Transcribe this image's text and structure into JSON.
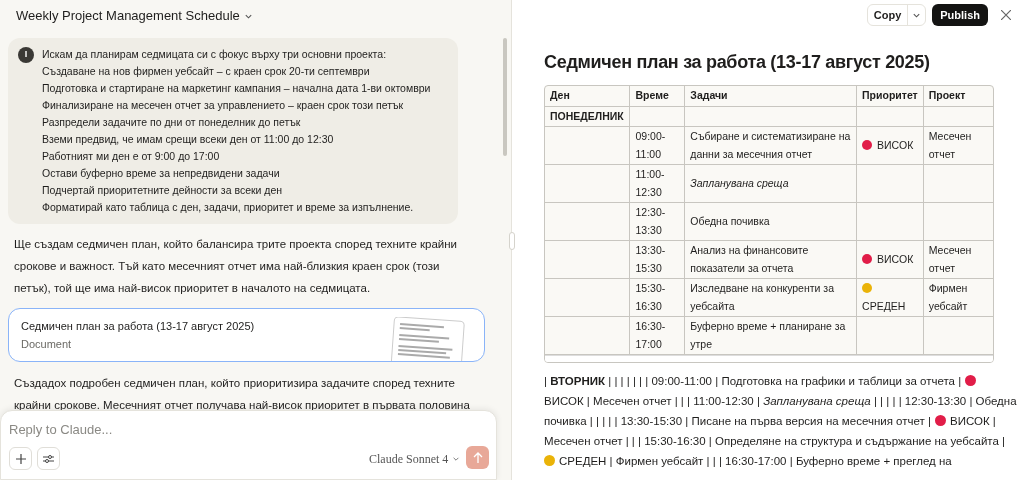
{
  "chat": {
    "title": "Weekly Project Management Schedule",
    "user_message": {
      "avatar": "I",
      "lines": [
        "Искам да планирам седмицата си с фокус върху три основни проекта:",
        "Създаване на нов фирмен уебсайт – с краен срок 20-ти септември",
        "Подготовка и стартиране на маркетинг кампания – начална дата 1-ви октомври",
        "Финализиране на месечен отчет за управлението – краен срок този петък",
        "Разпредели задачите по дни от понеделник до петък",
        "Вземи предвид, че имам срещи всеки ден от 11:00 до 12:30",
        "Работният ми ден е от 9:00 до 17:00",
        "Остави буферно време за непредвидени задачи",
        "Подчертай приоритетните дейности за всеки ден",
        "Форматирай като таблица с ден, задачи, приоритет и време за изпълнение."
      ]
    },
    "reply_before": "Ще създам седмичен план, който балансира трите проекта според техните крайни срокове и важност. Тъй като месечният отчет има най-близкия краен срок (този петък), той ще има най-висок приоритет в началото на седмицата.",
    "artifact": {
      "title": "Седмичен план за работа (13-17 август 2025)",
      "type": "Document"
    },
    "reply_after": "Създадох подробен седмичен план, който приоритизира задачите според техните крайни срокове. Месечният отчет получава най-висок приоритет в първата половина",
    "composer": {
      "placeholder": "Reply to Claude...",
      "model": "Claude Sonnet 4"
    }
  },
  "document": {
    "buttons": {
      "copy": "Copy",
      "publish": "Publish"
    },
    "title": "Седмичен план за работа (13-17 август 2025)",
    "table": {
      "columns": [
        "Ден",
        "Време",
        "Задачи",
        "Приоритет",
        "Проект"
      ],
      "rows": [
        {
          "day": "ПОНЕДЕЛНИК"
        },
        {
          "time": "09:00-11:00",
          "task": "Събиране и систематизиране на данни за месечния отчет",
          "priority": {
            "label": "ВИСОК",
            "color": "#e11d48"
          },
          "project": "Месечен отчет"
        },
        {
          "time": "11:00-12:30",
          "task": "Запланувана среща",
          "task_italic": true
        },
        {
          "time": "12:30-13:30",
          "task": "Обедна почивка"
        },
        {
          "time": "13:30-15:30",
          "task": "Анализ на финансовите показатели за отчета",
          "priority": {
            "label": "ВИСОК",
            "color": "#e11d48"
          },
          "project": "Месечен отчет"
        },
        {
          "time": "15:30-16:30",
          "task": "Изследване на конкуренти за уебсайта",
          "priority": {
            "label": "СРЕДЕН",
            "color": "#eab308"
          },
          "project": "Фирмен уебсайт"
        },
        {
          "time": "16:30-17:00",
          "task": "Буферно време + планиране за утре"
        }
      ]
    },
    "markdown_lines": [
      [
        {
          "kind": "text",
          "text": "| **ВТОРНИК** | | | | | | | 09:00-11:00 | Подготовка на графики и таблици за отчета |"
        },
        {
          "kind": "dot",
          "color": "#e11d48"
        }
      ],
      [
        {
          "kind": "text",
          "text": "ВИСОК | Месечен отчет | | | 11:00-12:30 | *Запланувана среща* | | | | | 12:30-13:30 | Обедна"
        }
      ],
      [
        {
          "kind": "text",
          "text": "почивка | | | | | 13:30-15:30 | Писане на първа версия на месечния отчет |"
        },
        {
          "kind": "dot",
          "color": "#e11d48"
        },
        {
          "kind": "text",
          "text": "ВИСОК |"
        }
      ],
      [
        {
          "kind": "text",
          "text": "Месечен отчет | | | 15:30-16:30 | Определяне на структура и съдържание на уебсайта |"
        }
      ],
      [
        {
          "kind": "dot",
          "color": "#eab308"
        },
        {
          "kind": "text",
          "text": "СРЕДЕН | Фирмен уебсайт | | | 16:30-17:00 | Буферно време + преглед на"
        }
      ]
    ]
  }
}
